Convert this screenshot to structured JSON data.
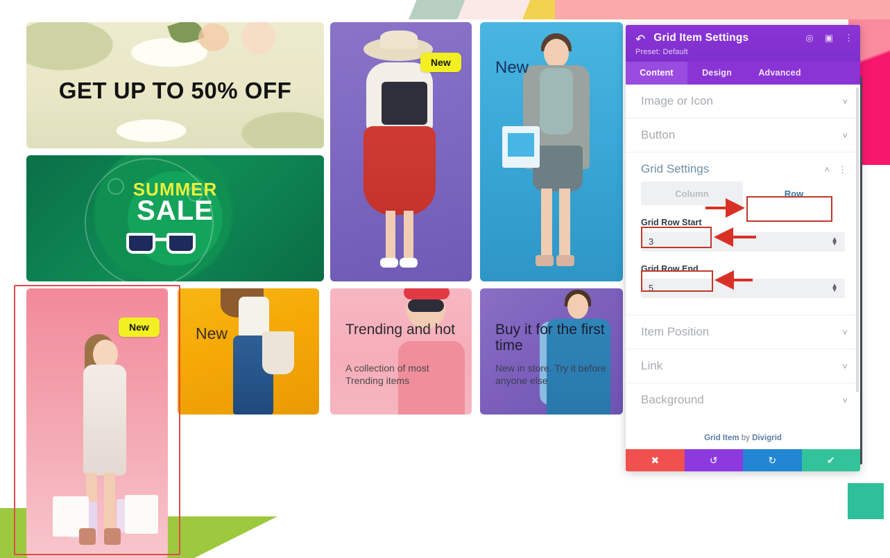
{
  "canvas": {
    "cards": [
      {
        "id": "sale-banner",
        "title": "GET UP TO 50% OFF"
      },
      {
        "id": "summer-sale",
        "line1": "SUMMER",
        "line2": "SALE"
      },
      {
        "id": "purple-hat-girl",
        "badge": "New"
      },
      {
        "id": "blue-girl",
        "label": "New"
      },
      {
        "id": "pink-shopping-girl",
        "badge": "New"
      },
      {
        "id": "yellow-jeans-girl",
        "label": "New"
      },
      {
        "id": "trending-card",
        "title": "Trending and hot",
        "subtitle": "A collection of most Trending items"
      },
      {
        "id": "buy-first-time-card",
        "title": "Buy it for the first time",
        "subtitle": "New in store. Try it before anyone else"
      }
    ]
  },
  "panel": {
    "title": "Grid Item Settings",
    "back_icon": "back-arrow-icon",
    "preset": "Preset: Default",
    "header_icons": [
      "target-icon",
      "layout-icon",
      "more-vertical-icon"
    ],
    "tabs": [
      {
        "label": "Content",
        "active": true
      },
      {
        "label": "Design",
        "active": false
      },
      {
        "label": "Advanced",
        "active": false
      }
    ],
    "sections": [
      {
        "label": "Image or Icon",
        "state": "collapsed"
      },
      {
        "label": "Button",
        "state": "collapsed"
      },
      {
        "label": "Grid Settings",
        "state": "expanded"
      },
      {
        "label": "Item Position",
        "state": "collapsed"
      },
      {
        "label": "Link",
        "state": "collapsed"
      },
      {
        "label": "Background",
        "state": "collapsed"
      }
    ],
    "grid_settings": {
      "toggle": {
        "option_left": "Column",
        "option_right": "Row",
        "selected": "Row"
      },
      "fields": [
        {
          "label": "Grid Row Start",
          "value": "3"
        },
        {
          "label": "Grid Row End",
          "value": "5"
        }
      ]
    },
    "credit_prefix": "Grid Item",
    "credit_mid": " by ",
    "credit_suffix": "Divigrid",
    "actions": [
      {
        "name": "close",
        "glyph": "✖"
      },
      {
        "name": "undo",
        "glyph": "↺"
      },
      {
        "name": "redo",
        "glyph": "↻"
      },
      {
        "name": "save",
        "glyph": "✔"
      }
    ]
  },
  "colors": {
    "panel_header": "#8b34d6",
    "tab_active": "#9a4ce0",
    "annotation_red": "#c0392b",
    "badge_yellow": "#f2ef22",
    "action_close": "#f0514e",
    "action_undo": "#8c3ae0",
    "action_redo": "#2286d2",
    "action_save": "#33c39a"
  }
}
